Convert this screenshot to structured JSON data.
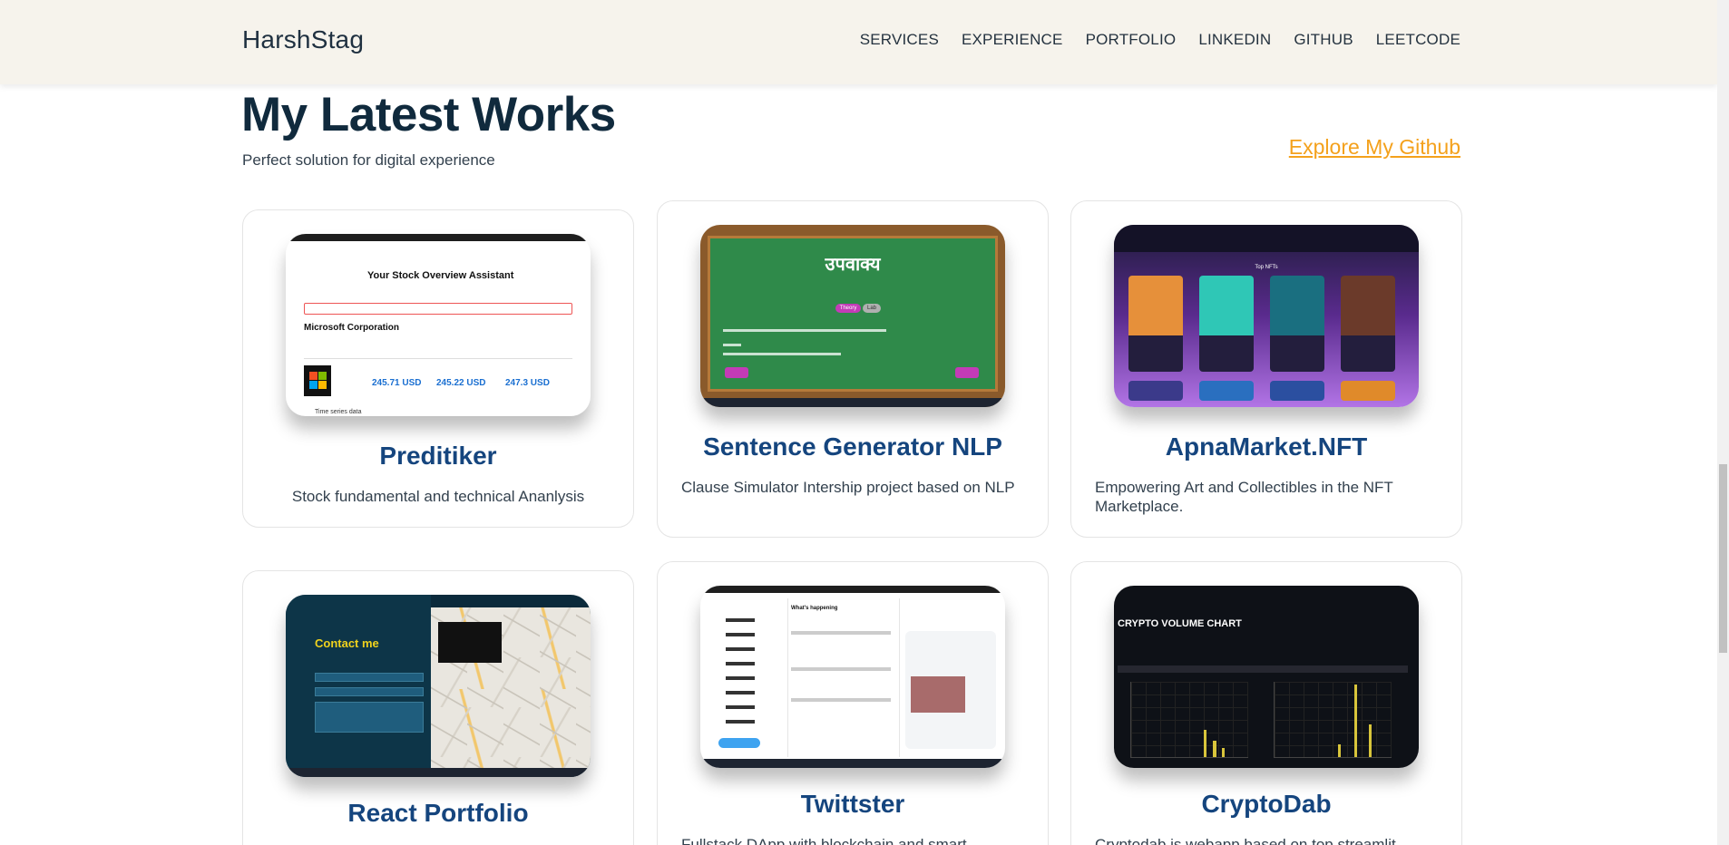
{
  "header": {
    "brand": "HarshStag",
    "nav": [
      "SERVICES",
      "EXPERIENCE",
      "PORTFOLIO",
      "LINKEDIN",
      "GITHUB",
      "LEETCODE"
    ]
  },
  "section": {
    "title": "My Latest Works",
    "subtitle": "Perfect solution for digital experience",
    "explore_link": "Explore My Github"
  },
  "projects": [
    {
      "title": "Preditiker",
      "description": "Stock fundamental and technical Ananlysis",
      "screenshot": {
        "app_title": "Your Stock Overview Assistant",
        "company": "Microsoft Corporation",
        "values": [
          "245.71 USD",
          "245.22 USD",
          "247.3 USD"
        ],
        "note": "Time series data"
      }
    },
    {
      "title": "Sentence Generator NLP",
      "description": "Clause Simulator Intership project based on NLP",
      "screenshot": {
        "board_heading": "उपवाक्य",
        "tabs": [
          "Theory",
          "Lab"
        ]
      }
    },
    {
      "title": "ApnaMarket.NFT",
      "description": "Empowering Art and Collectibles in the NFT Marketplace.",
      "screenshot": {
        "section_label": "Top NFTs"
      }
    },
    {
      "title": "React Portfolio",
      "description": "",
      "screenshot": {
        "heading": "Contact me"
      }
    },
    {
      "title": "Twittster",
      "description": "Fullstack DApp with blockchain and smart",
      "screenshot": {
        "heading": "What's happening"
      }
    },
    {
      "title": "CryptoDab",
      "description": "Cryptodab is webapp based on top streamlit",
      "screenshot": {
        "heading": "CRYPTO VOLUME CHART"
      }
    }
  ],
  "colors": {
    "header_bg": "#f6f3ec",
    "title": "#102a3d",
    "card_title": "#15457e",
    "link": "#f4a11c"
  }
}
